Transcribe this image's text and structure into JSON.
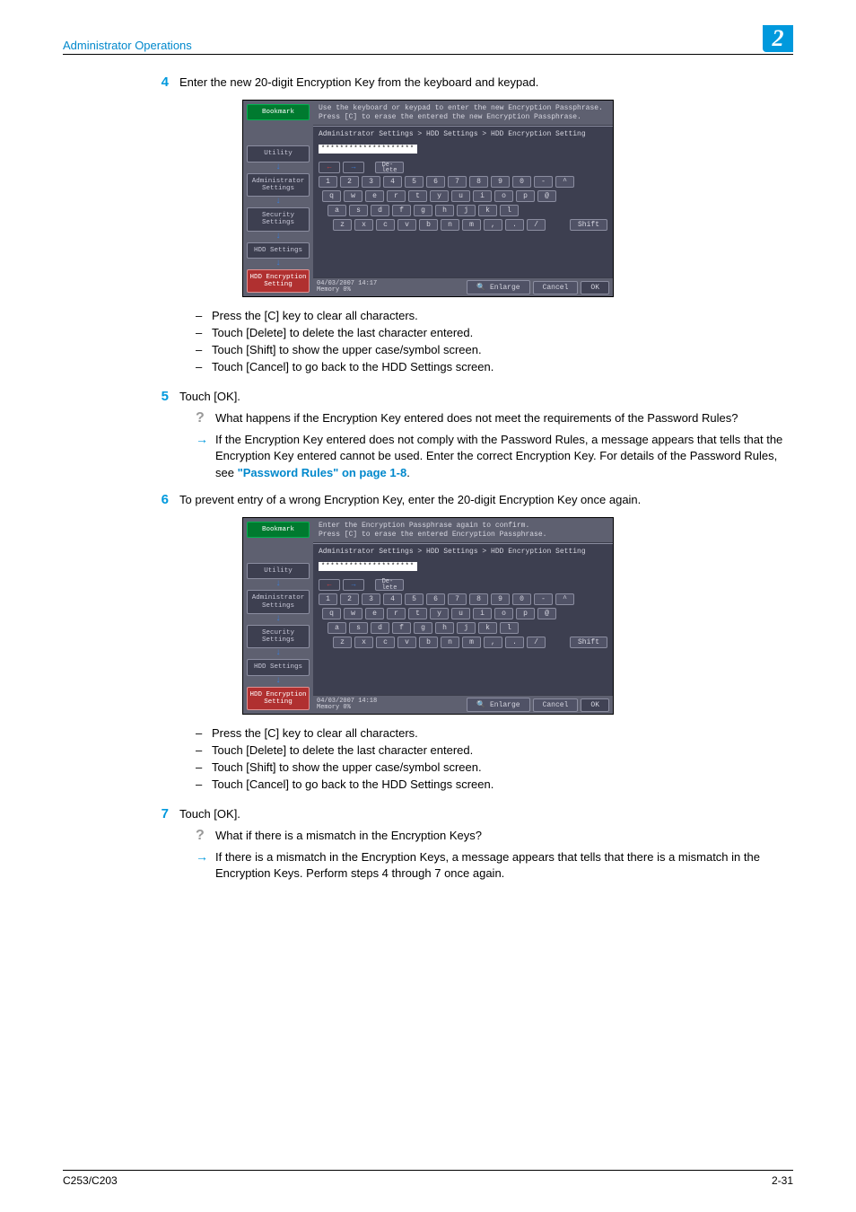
{
  "header": {
    "title": "Administrator Operations",
    "chapter": "2"
  },
  "footer": {
    "model": "C253/C203",
    "page": "2-31"
  },
  "step4": {
    "num": "4",
    "text": "Enter the new 20-digit Encryption Key from the keyboard and keypad."
  },
  "step4_bullets": [
    "Press the [C] key to clear all characters.",
    "Touch [Delete] to delete the last character entered.",
    "Touch [Shift] to show the upper case/symbol screen.",
    "Touch [Cancel] to go back to the HDD Settings screen."
  ],
  "step5": {
    "num": "5",
    "text": "Touch [OK].",
    "q": "What happens if the Encryption Key entered does not meet the requirements of the Password Rules?",
    "a_pre": "If the Encryption Key entered does not comply with the Password Rules, a message appears that tells that the Encryption Key entered cannot be used. Enter the correct Encryption Key. For details of the Password Rules, see ",
    "a_link": "\"Password Rules\" on page 1-8",
    "a_post": "."
  },
  "step6": {
    "num": "6",
    "text": "To prevent entry of a wrong Encryption Key, enter the 20-digit Encryption Key once again."
  },
  "step6_bullets": [
    "Press the [C] key to clear all characters.",
    "Touch [Delete] to delete the last character entered.",
    "Touch [Shift] to show the upper case/symbol screen.",
    "Touch [Cancel] to go back to the HDD Settings screen."
  ],
  "step7": {
    "num": "7",
    "text": "Touch [OK].",
    "q": "What if there is a mismatch in the Encryption Keys?",
    "a": "If there is a mismatch in the Encryption Keys, a message appears that tells that there is a mismatch in the Encryption Keys. Perform steps 4 through 7 once again."
  },
  "ss1": {
    "instr1": "Use the keyboard or keypad to enter the new Encryption Passphrase.",
    "instr2": "Press [C] to erase the entered the new Encryption Passphrase.",
    "breadcrumb": "Administrator Settings > HDD Settings > HDD Encryption Setting",
    "input": "********************",
    "datetime": "04/03/2007   14:17",
    "memory": "Memory         0%"
  },
  "ss2": {
    "instr1": "Enter the Encryption Passphrase again to confirm.",
    "instr2": "Press [C] to erase the entered Encryption Passphrase.",
    "breadcrumb": "Administrator Settings > HDD Settings > HDD Encryption Setting",
    "input": "********************",
    "datetime": "04/03/2007   14:18",
    "memory": "Memory         0%"
  },
  "ss_common": {
    "sidebar": {
      "bookmark": "Bookmark",
      "utility": "Utility",
      "admin": "Administrator\nSettings",
      "security": "Security\nSettings",
      "hdd": "HDD Settings",
      "enc": "HDD Encryption\nSetting"
    },
    "keys": {
      "delete": "De-\nlete",
      "shift": "Shift",
      "enlarge": "Enlarge",
      "cancel": "Cancel",
      "ok": "OK"
    },
    "row1": [
      "1",
      "2",
      "3",
      "4",
      "5",
      "6",
      "7",
      "8",
      "9",
      "0",
      "-",
      "^"
    ],
    "row2": [
      "q",
      "w",
      "e",
      "r",
      "t",
      "y",
      "u",
      "i",
      "o",
      "p",
      "@"
    ],
    "row3": [
      "a",
      "s",
      "d",
      "f",
      "g",
      "h",
      "j",
      "k",
      "l"
    ],
    "row4": [
      "z",
      "x",
      "c",
      "v",
      "b",
      "n",
      "m",
      ",",
      ".",
      "/"
    ]
  }
}
